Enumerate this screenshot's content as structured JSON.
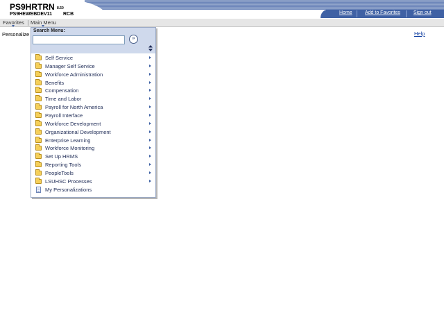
{
  "header": {
    "app_name": "PS9HRTRN",
    "version": "8.50",
    "database": "PS9HEWEBDEV11",
    "user": "RCB",
    "links": [
      "Home",
      "Add to Favorites",
      "Sign out"
    ]
  },
  "menubar": {
    "favorites": "Favorites",
    "main_menu": "Main Menu"
  },
  "page": {
    "personalize": "Personalize",
    "help": "Help"
  },
  "menu": {
    "search_label": "Search Menu:",
    "search_value": "",
    "go_icon": "go-arrow-icon",
    "sort_icon": "sort-icon",
    "items": [
      {
        "label": "Self Service",
        "icon": "folder-icon",
        "has_submenu": true
      },
      {
        "label": "Manager Self Service",
        "icon": "folder-icon",
        "has_submenu": true
      },
      {
        "label": "Workforce Administration",
        "icon": "folder-icon",
        "has_submenu": true
      },
      {
        "label": "Benefits",
        "icon": "folder-icon",
        "has_submenu": true
      },
      {
        "label": "Compensation",
        "icon": "folder-icon",
        "has_submenu": true
      },
      {
        "label": "Time and Labor",
        "icon": "folder-icon",
        "has_submenu": true
      },
      {
        "label": "Payroll for North America",
        "icon": "folder-icon",
        "has_submenu": true
      },
      {
        "label": "Payroll Interface",
        "icon": "folder-icon",
        "has_submenu": true
      },
      {
        "label": "Workforce Development",
        "icon": "folder-icon",
        "has_submenu": true
      },
      {
        "label": "Organizational Development",
        "icon": "folder-icon",
        "has_submenu": true
      },
      {
        "label": "Enterprise Learning",
        "icon": "folder-icon",
        "has_submenu": true
      },
      {
        "label": "Workforce Monitoring",
        "icon": "folder-icon",
        "has_submenu": true
      },
      {
        "label": "Set Up HRMS",
        "icon": "folder-icon",
        "has_submenu": true
      },
      {
        "label": "Reporting Tools",
        "icon": "folder-icon",
        "has_submenu": true
      },
      {
        "label": "PeopleTools",
        "icon": "folder-icon",
        "has_submenu": true
      },
      {
        "label": "LSUHSC Processes",
        "icon": "folder-icon",
        "has_submenu": true
      },
      {
        "label": "My Personalizations",
        "icon": "document-icon",
        "has_submenu": false
      }
    ]
  },
  "colors": {
    "nav_bar": "#3f61a4",
    "menu_search_bg": "#cfd9ec",
    "folder": "#f5cf58"
  }
}
